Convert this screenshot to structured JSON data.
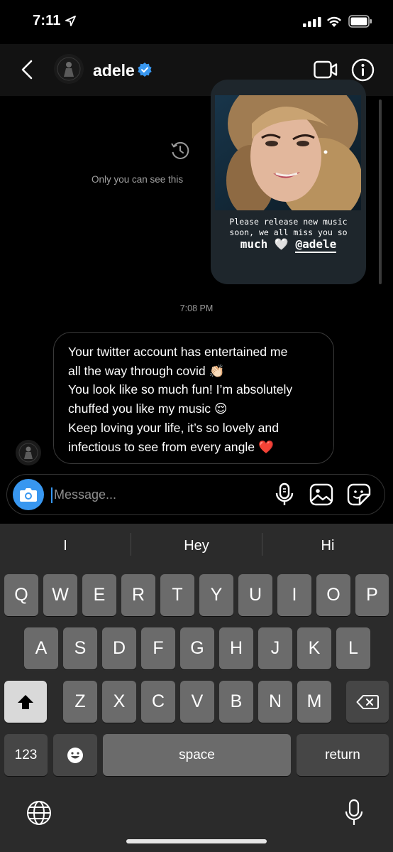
{
  "status_bar": {
    "time": "7:11"
  },
  "header": {
    "name": "adele"
  },
  "story": {
    "line1": "Please release new music",
    "line2": "soon, we all miss you so",
    "line3_word": "much",
    "line3_heart": "🤍",
    "mention": "@adele"
  },
  "notice": {
    "only_you": "Only you can see this"
  },
  "timestamp": "7:08 PM",
  "message": {
    "lines": [
      "Your twitter account has entertained me",
      "all the way through covid 👏🏻",
      "You look like so much fun! I’m absolutely",
      "chuffed you like my music 😌",
      "Keep loving your life, it’s so lovely and",
      "infectious to see from every angle ❤️"
    ]
  },
  "composer": {
    "placeholder": "Message..."
  },
  "keyboard": {
    "suggestions": [
      "I",
      "Hey",
      "Hi"
    ],
    "row1": [
      "Q",
      "W",
      "E",
      "R",
      "T",
      "Y",
      "U",
      "I",
      "O",
      "P"
    ],
    "row2": [
      "A",
      "S",
      "D",
      "F",
      "G",
      "H",
      "J",
      "K",
      "L"
    ],
    "row3": [
      "Z",
      "X",
      "C",
      "V",
      "B",
      "N",
      "M"
    ],
    "numbers_label": "123",
    "space_label": "space",
    "return_label": "return"
  },
  "colors": {
    "accent": "#3897f0",
    "verified": "#3897f0",
    "heart": "#e0162b"
  }
}
